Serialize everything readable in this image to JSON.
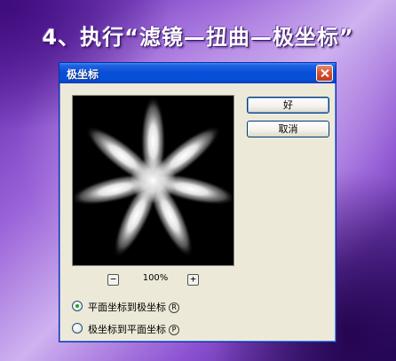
{
  "heading": "4、执行“滤镜—扭曲—极坐标”",
  "dialog": {
    "title": "极坐标",
    "ok_label": "好",
    "cancel_label": "取消",
    "zoom": {
      "minus": "−",
      "plus": "+",
      "level": "100%"
    },
    "options": [
      {
        "label": "平面坐标到极坐标",
        "hotkey": "R",
        "checked": true
      },
      {
        "label": "极坐标到平面坐标",
        "hotkey": "P",
        "checked": false
      }
    ]
  },
  "icons": {
    "close": "close-icon"
  }
}
